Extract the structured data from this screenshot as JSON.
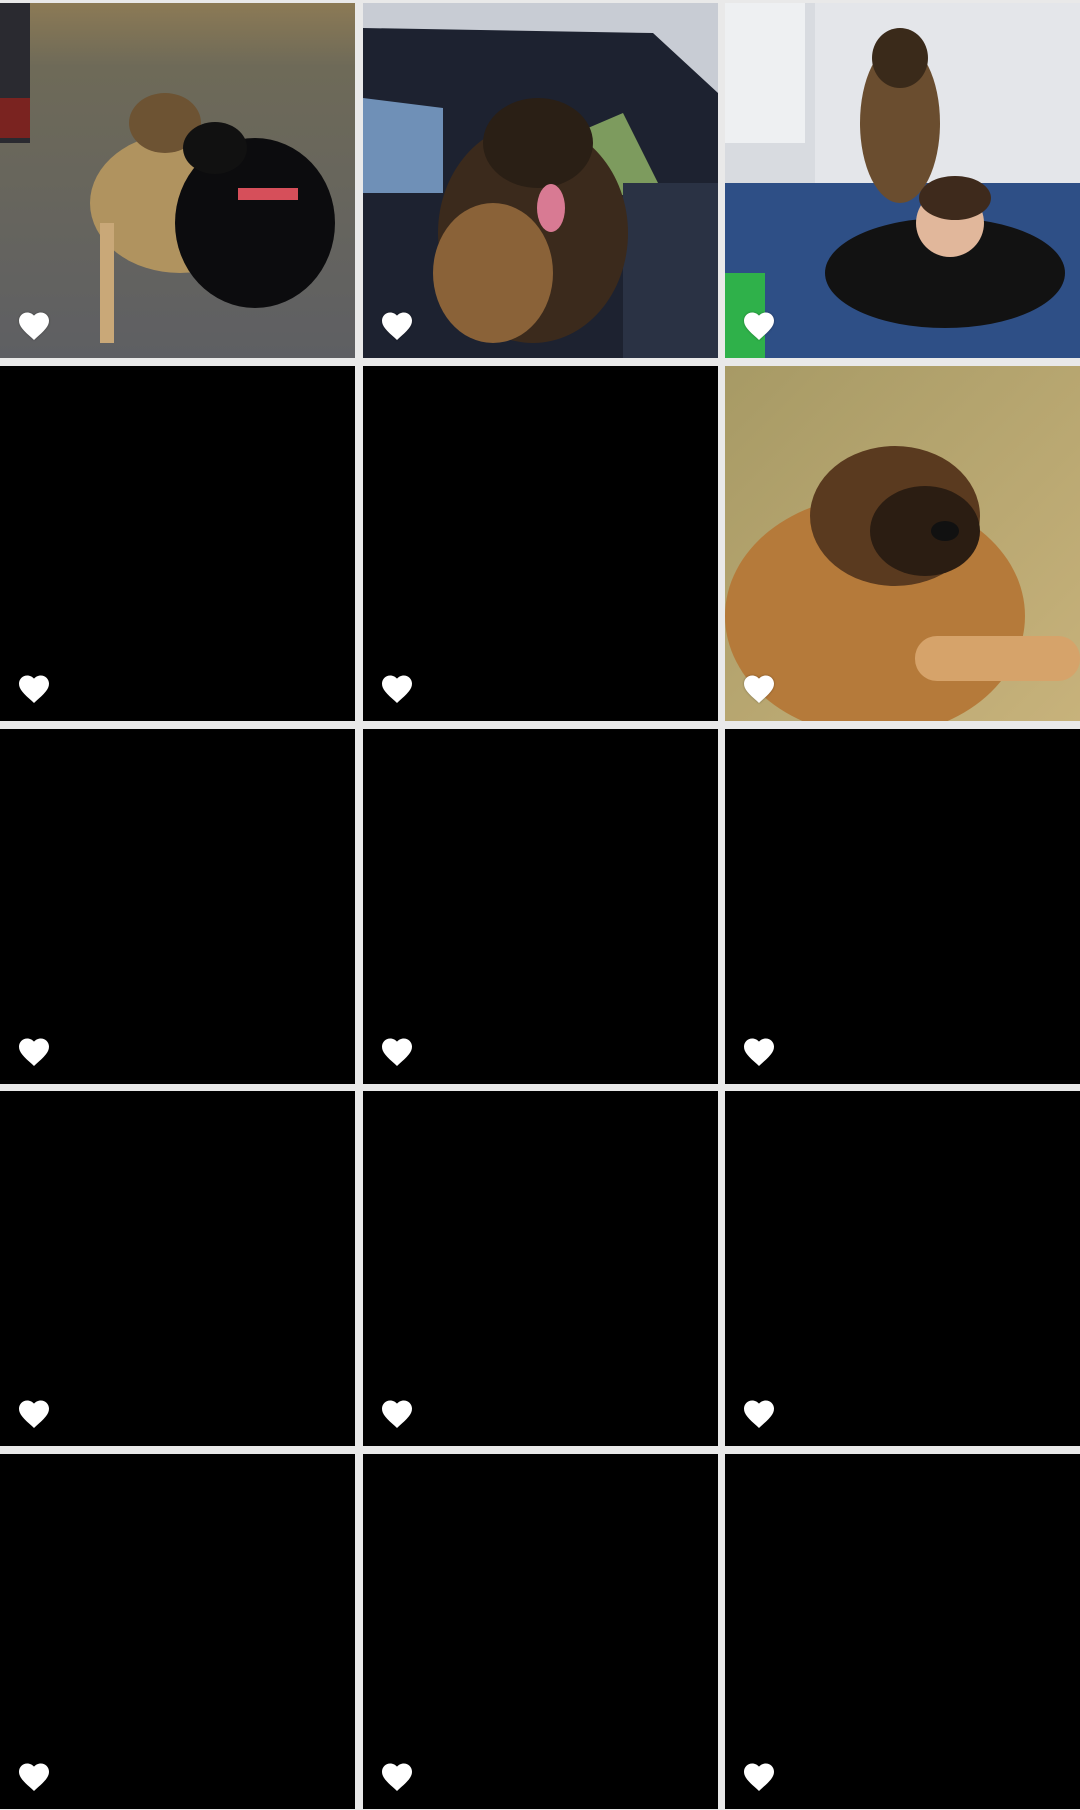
{
  "gallery": {
    "columns": 3,
    "rows": 5,
    "heart_icon": "heart-icon",
    "heart_color": "#ffffff",
    "tile_empty_color": "#000000",
    "tiles": [
      {
        "state": "photo",
        "scene": "two-dogs-on-gravel"
      },
      {
        "state": "photo",
        "scene": "dog-in-car"
      },
      {
        "state": "photo",
        "scene": "dog-with-boy-by-garage"
      },
      {
        "state": "empty"
      },
      {
        "state": "empty"
      },
      {
        "state": "photo",
        "scene": "dog-lying-on-grass"
      },
      {
        "state": "empty"
      },
      {
        "state": "empty"
      },
      {
        "state": "empty"
      },
      {
        "state": "empty"
      },
      {
        "state": "empty"
      },
      {
        "state": "empty"
      },
      {
        "state": "empty"
      },
      {
        "state": "empty"
      },
      {
        "state": "empty"
      }
    ]
  }
}
